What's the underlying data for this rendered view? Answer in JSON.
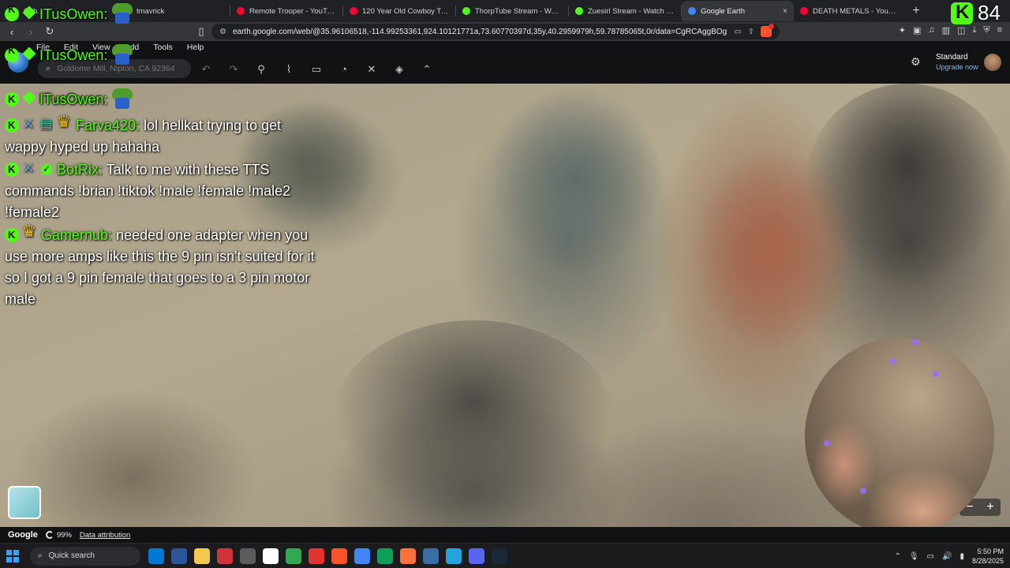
{
  "browser": {
    "tabs": [
      {
        "title": "Gith...",
        "color": "#4a4a4a",
        "active": false
      },
      {
        "title": "tmavrick",
        "color": "#53fc18",
        "active": false
      },
      {
        "title": "Remote Trooper - YouTube",
        "color": "#ff0033",
        "active": false
      },
      {
        "title": "120 Year Old Cowboy Trash - Y",
        "color": "#ff0033",
        "active": false
      },
      {
        "title": "ThorpTube Stream - Watch Live",
        "color": "#53fc18",
        "active": false
      },
      {
        "title": "Zuesirl Stream - Watch Live",
        "color": "#53fc18",
        "active": false
      },
      {
        "title": "Google Earth",
        "color": "#4285f4",
        "active": true
      },
      {
        "title": "DEATH METALS - YouTube",
        "color": "#ff0033",
        "active": false
      }
    ],
    "close_glyph": "×",
    "new_tab_glyph": "+",
    "url": "earth.google.com/web/@35.96106518,-114.99253361,924.10121771a,73.60770397d,35y,40.2959979h,59.78785065t,0r/data=CgRCAggBOgMKA..."
  },
  "earth": {
    "menu": [
      "File",
      "Edit",
      "View",
      "Add",
      "Tools",
      "Help"
    ],
    "search_placeholder": "Goldome Mill, Nipton, CA 92364",
    "account_plan": "Standard",
    "account_action": "Upgrade now",
    "status_brand": "Google",
    "status_percent": "99%",
    "status_attribution": "Data attribution",
    "zoom_minus": "−",
    "zoom_plus": "+"
  },
  "overlay": {
    "counter_value": "84",
    "top_users": [
      "ITusOwen:",
      "ITusOwen:",
      "ITusOwen:"
    ]
  },
  "chat": [
    {
      "user": "Farva420:",
      "text": "lol hellkat trying to get wappy hyped up hahaha"
    },
    {
      "user": "BotRix:",
      "text": "Talk to me with these TTS commands !brian !tiktok !male !female !male2 !female2"
    },
    {
      "user": "Gamernub:",
      "text": "needed one adapter when you use more amps like this the 9 pin isn't suited for it so I got a 9 pin female that goes to a 3 pin motor male"
    }
  ],
  "taskbar": {
    "search_label": "Quick search",
    "time": "5:50 PM",
    "date": "8/28/2025",
    "app_colors": [
      "#0078d4",
      "#2b579a",
      "#f2c94c",
      "#d13438",
      "#5c5c5c",
      "#ffffff",
      "#32a852",
      "#e3342f",
      "#fb542b",
      "#4285f4",
      "#0f9d58",
      "#ff7139",
      "#3a6ea5",
      "#23a5dc",
      "#5865f2",
      "#1b2838"
    ]
  },
  "colors": {
    "kick_green": "#53fc18",
    "chat_text": "#ffffff",
    "crown_gold": "#f6c12b"
  }
}
